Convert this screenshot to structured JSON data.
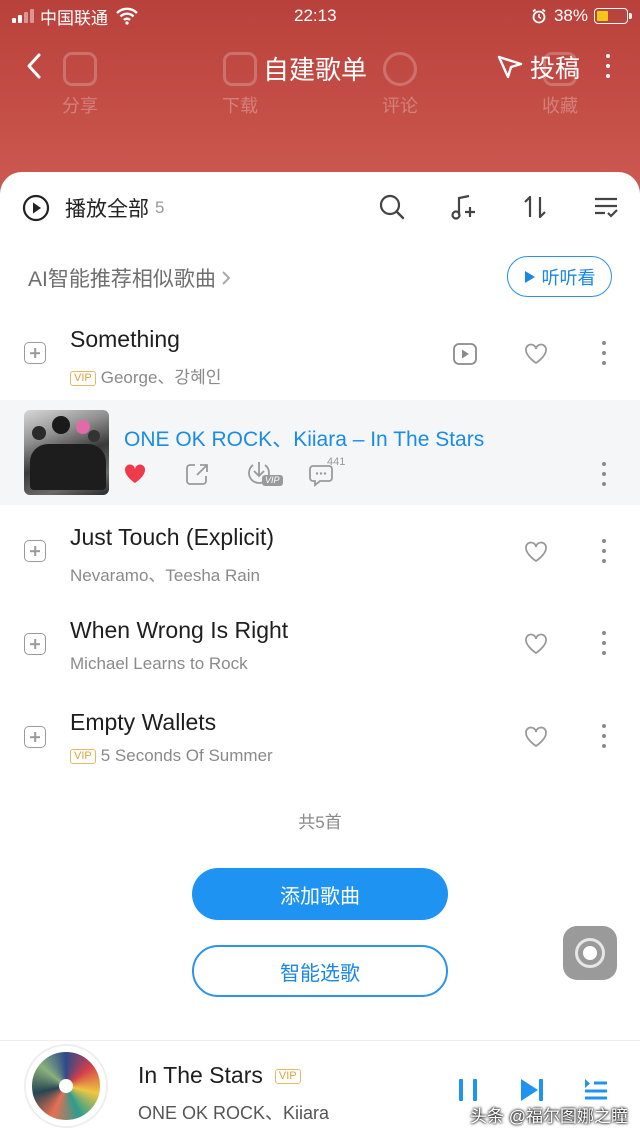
{
  "status_bar": {
    "carrier": "中国联通",
    "time": "22:13",
    "battery": "38%"
  },
  "nav": {
    "title": "自建歌单",
    "submit_label": "投稿"
  },
  "header_actions": [
    "分享",
    "下载",
    "评论",
    "收藏"
  ],
  "toolbar": {
    "play_all_label": "播放全部",
    "count": "5"
  },
  "ai": {
    "label": "AI智能推荐相似歌曲",
    "listen_label": "听听看"
  },
  "songs": [
    {
      "title": "Something",
      "vip": "VIP",
      "artist": "George、강혜인"
    },
    {
      "title": "ONE OK ROCK、Kiiara – In The Stars",
      "comments": "441",
      "dl_badge": "VIP"
    },
    {
      "title": "Just Touch (Explicit)",
      "vip": "",
      "artist": "Nevaramo、Teesha Rain"
    },
    {
      "title": "When Wrong Is Right",
      "vip": "",
      "artist": "Michael Learns to Rock"
    },
    {
      "title": "Empty Wallets",
      "vip": "VIP",
      "artist": "5 Seconds Of Summer"
    }
  ],
  "total_label": "共5首",
  "buttons": {
    "add_songs": "添加歌曲",
    "smart_pick": "智能选歌"
  },
  "player": {
    "title": "In The Stars",
    "vip": "VIP",
    "artist": "ONE OK ROCK、Kiiara"
  },
  "watermark": "头条 @福尔图娜之瞳",
  "colors": {
    "header": "#c0463f",
    "accent": "#1f93f1",
    "active_title": "#1a8ce6",
    "like": "#ee3a4a"
  }
}
